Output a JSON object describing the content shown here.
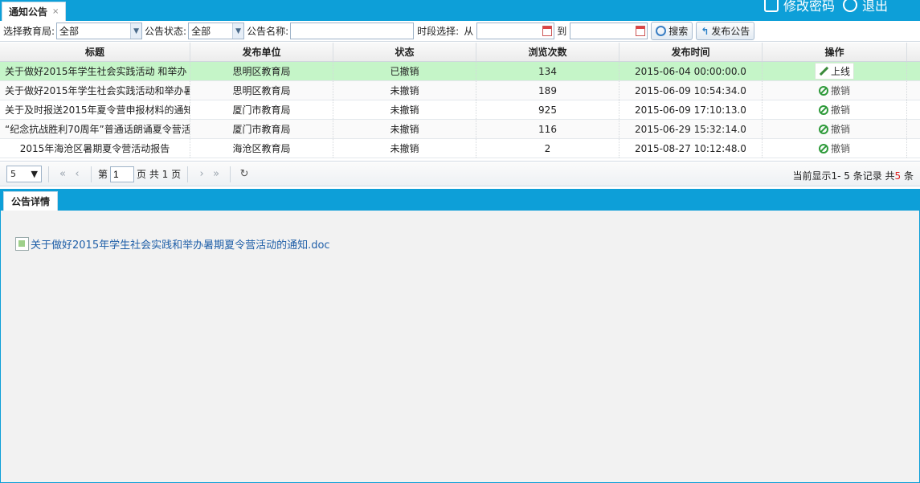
{
  "top_tab": {
    "label": "通知公告",
    "close": "×"
  },
  "top_links": {
    "change_password": "修改密码",
    "logout": "退出"
  },
  "filters": {
    "bureau_label": "选择教育局:",
    "bureau_value": "全部",
    "status_label": "公告状态:",
    "status_value": "全部",
    "name_label": "公告名称:",
    "name_value": "",
    "period_label": "时段选择:",
    "from_label": "从",
    "to_label": "到",
    "date_from": "",
    "date_to": "",
    "search_btn": "搜索",
    "publish_btn": "发布公告"
  },
  "table": {
    "headers": [
      "标题",
      "发布单位",
      "状态",
      "浏览次数",
      "发布时间",
      "操作"
    ],
    "rows": [
      {
        "title": "关于做好2015年学生社会实践活动 和举办",
        "unit": "思明区教育局",
        "status": "已撤销",
        "views": "134",
        "time": "2015-06-04 00:00:00.0",
        "action": "上线"
      },
      {
        "title": "关于做好2015年学生社会实践活动和举办暑",
        "unit": "思明区教育局",
        "status": "未撤销",
        "views": "189",
        "time": "2015-06-09 10:54:34.0",
        "action": "撤销"
      },
      {
        "title": "关于及时报送2015年夏令营申报材料的通知",
        "unit": "厦门市教育局",
        "status": "未撤销",
        "views": "925",
        "time": "2015-06-09 17:10:13.0",
        "action": "撤销"
      },
      {
        "title": "“纪念抗战胜利70周年”普通话朗诵夏令营活",
        "unit": "厦门市教育局",
        "status": "未撤销",
        "views": "116",
        "time": "2015-06-29 15:32:14.0",
        "action": "撤销"
      },
      {
        "title": "2015年海沧区暑期夏令营活动报告",
        "unit": "海沧区教育局",
        "status": "未撤销",
        "views": "2",
        "time": "2015-08-27 10:12:48.0",
        "action": "撤销"
      }
    ]
  },
  "pager": {
    "page_size": "5",
    "page_prefix": "第",
    "page_value": "1",
    "page_suffix": "页 共 1 页",
    "info_prefix": "当前显示1- 5 条记录 共",
    "info_total": "5",
    "info_suffix": " 条"
  },
  "detail": {
    "tab_label": "公告详情",
    "attachment": "关于做好2015年学生社会实践和举办暑期夏令营活动的通知.doc"
  },
  "colors": {
    "accent": "#0d9fd8",
    "selected_row": "#c5f5c8",
    "link": "#1f5fa8"
  }
}
